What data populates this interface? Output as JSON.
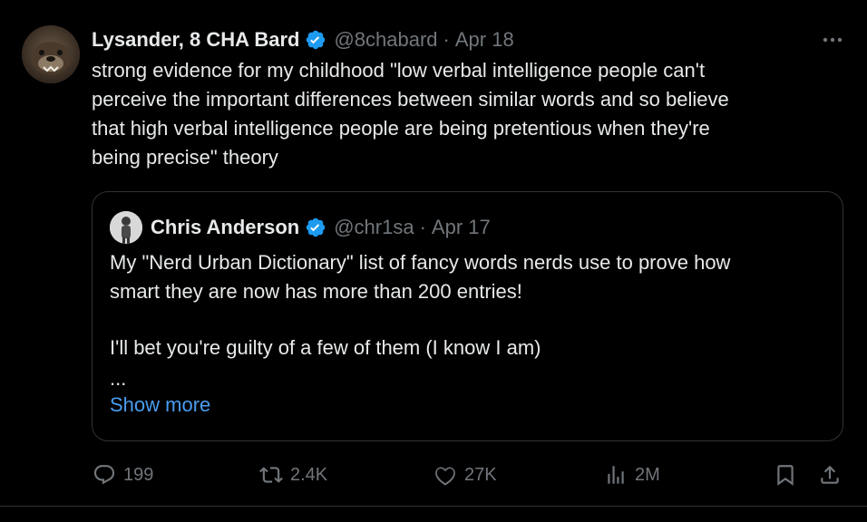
{
  "author": {
    "display_name": "Lysander, 8 CHA Bard",
    "handle": "@8chabard",
    "separator": "·",
    "date": "Apr 18"
  },
  "tweet": {
    "text": "strong evidence for my childhood \"low verbal intelligence people can't\nperceive the important differences between similar words and so believe\nthat high verbal intelligence people are being pretentious when they're\nbeing precise\" theory"
  },
  "quoted": {
    "display_name": "Chris Anderson",
    "handle": "@chr1sa",
    "separator": "·",
    "date": "Apr 17",
    "line1": "My \"Nerd Urban Dictionary\" list of fancy words nerds use to prove how",
    "line2": "smart they are now has more than 200 entries!",
    "line3": "I'll bet you're guilty of a few of them (I know I am)",
    "ellipsis": "...",
    "show_more": "Show more"
  },
  "actions": {
    "replies": "199",
    "retweets": "2.4K",
    "likes": "27K",
    "views": "2M"
  },
  "colors": {
    "background": "#000000",
    "text": "#e7e9ea",
    "muted": "#71767b",
    "verified": "#1d9bf0",
    "link": "#4a9df0",
    "border": "#2f3336"
  },
  "icons": [
    "verified-badge-icon",
    "more-icon",
    "reply-icon",
    "retweet-icon",
    "like-icon",
    "views-icon",
    "bookmark-icon",
    "share-icon"
  ]
}
